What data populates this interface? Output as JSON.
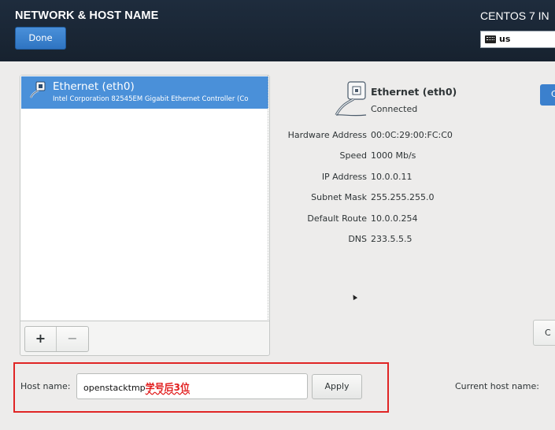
{
  "header": {
    "title": "NETWORK & HOST NAME",
    "done_label": "Done",
    "product": "CENTOS 7 IN",
    "keyboard_layout": "us",
    "bg_color": "#1b2735",
    "accent_color": "#3f86d4"
  },
  "devices": [
    {
      "name": "Ethernet (eth0)",
      "description": "Intel Corporation 82545EM Gigabit Ethernet Controller (Co",
      "icon": "ethernet-icon",
      "selected": true
    }
  ],
  "list_buttons": {
    "add": "+",
    "remove": "−"
  },
  "details": {
    "icon": "ethernet-icon",
    "name": "Ethernet (eth0)",
    "status": "Connected",
    "configure_label": "C",
    "side_label": "C",
    "rows": [
      {
        "label": "Hardware Address",
        "value": "00:0C:29:00:FC:C0"
      },
      {
        "label": "Speed",
        "value": "1000 Mb/s"
      },
      {
        "label": "IP Address",
        "value": "10.0.0.11"
      },
      {
        "label": "Subnet Mask",
        "value": "255.255.255.0"
      },
      {
        "label": "Default Route",
        "value": "10.0.0.254"
      },
      {
        "label": "DNS",
        "value": "233.5.5.5"
      }
    ]
  },
  "hostname": {
    "label": "Host name:",
    "value": "openstacktmp",
    "annotation": "学号后3位",
    "annotation_color": "#e11c1c",
    "apply_label": "Apply",
    "current_label": "Current host name:"
  }
}
